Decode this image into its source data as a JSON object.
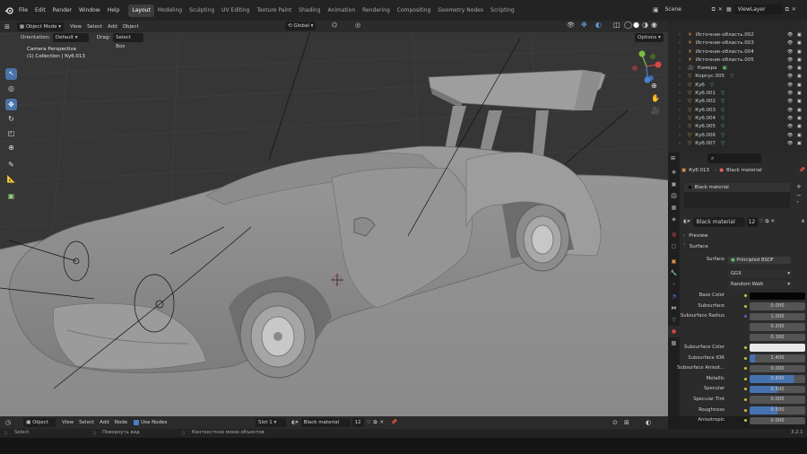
{
  "menu": [
    "File",
    "Edit",
    "Render",
    "Window",
    "Help"
  ],
  "workspaces": [
    "Layout",
    "Modeling",
    "Sculpting",
    "UV Editing",
    "Texture Paint",
    "Shading",
    "Animation",
    "Rendering",
    "Compositing",
    "Geometry Nodes",
    "Scripting"
  ],
  "scene_label": "Scene",
  "view_layer_label": "ViewLayer",
  "viewport_header": {
    "mode": "Object Mode",
    "menus": [
      "View",
      "Select",
      "Add",
      "Object"
    ],
    "transform": "Global",
    "orientation_label": "Orientation:",
    "orientation_value": "Default",
    "drag_label": "Drag:",
    "drag_value": "Select Box",
    "options": "Options"
  },
  "overlay": {
    "line1": "Camera Perspective",
    "line2": "(1) Collection | Куб.013"
  },
  "outliner_rows": [
    {
      "name": "Источник-область.002",
      "type": "light"
    },
    {
      "name": "Источник-область.003",
      "type": "light"
    },
    {
      "name": "Источник-область.004",
      "type": "light"
    },
    {
      "name": "Источник-область.005",
      "type": "light"
    },
    {
      "name": "Камера",
      "type": "camera"
    },
    {
      "name": "Корпус.005",
      "type": "mesh"
    },
    {
      "name": "Куб",
      "type": "mesh"
    },
    {
      "name": "Куб.001",
      "type": "mesh"
    },
    {
      "name": "Куб.002",
      "type": "mesh"
    },
    {
      "name": "Куб.003",
      "type": "mesh"
    },
    {
      "name": "Куб.004",
      "type": "mesh"
    },
    {
      "name": "Куб.005",
      "type": "mesh"
    },
    {
      "name": "Куб.006",
      "type": "mesh"
    },
    {
      "name": "Куб.007",
      "type": "mesh"
    }
  ],
  "properties": {
    "object_name": "Куб.013",
    "material_name": "Black material",
    "slot_name": "Black material",
    "users": "12",
    "preview": "Preview",
    "surface_section": "Surface",
    "surface_label": "Surface",
    "surface_value": "Principled BSDF",
    "distribution": "GGX",
    "subsurface_method": "Random Walk",
    "rows": [
      {
        "label": "Base Color",
        "value": "",
        "kind": "color",
        "color": "#050505"
      },
      {
        "label": "Subsurface",
        "value": "0.000",
        "kind": "num",
        "fill": 0
      },
      {
        "label": "Subsurface Radius",
        "value": "1.000",
        "kind": "num",
        "fill": 0
      },
      {
        "label": "",
        "value": "0.200",
        "kind": "num",
        "fill": 0
      },
      {
        "label": "",
        "value": "0.100",
        "kind": "num",
        "fill": 0
      },
      {
        "label": "Subsurface Color",
        "value": "",
        "kind": "color",
        "color": "#e8e8e8"
      },
      {
        "label": "Subsurface IOR",
        "value": "1.400",
        "kind": "num",
        "fill": 0.1
      },
      {
        "label": "Subsurface Anisot...",
        "value": "0.000",
        "kind": "num",
        "fill": 0
      },
      {
        "label": "Metallic",
        "value": "0.800",
        "kind": "num",
        "fill": 0.8
      },
      {
        "label": "Specular",
        "value": "0.500",
        "kind": "num",
        "fill": 0.5
      },
      {
        "label": "Specular Tint",
        "value": "0.000",
        "kind": "num",
        "fill": 0
      },
      {
        "label": "Roughness",
        "value": "0.500",
        "kind": "num",
        "fill": 0.5
      },
      {
        "label": "Anisotropic",
        "value": "0.000",
        "kind": "num",
        "fill": 0
      }
    ]
  },
  "timeline": {
    "editor": "Object",
    "menus": [
      "View",
      "Select",
      "Add",
      "Node"
    ],
    "use_nodes": "Use Nodes",
    "slot": "Slot 1",
    "material": "Black material",
    "users": "12"
  },
  "statusbar": {
    "select": "Select",
    "rotate": "Повернуть вид",
    "context": "Контекстное меню объектов",
    "version": "3.2.1"
  }
}
